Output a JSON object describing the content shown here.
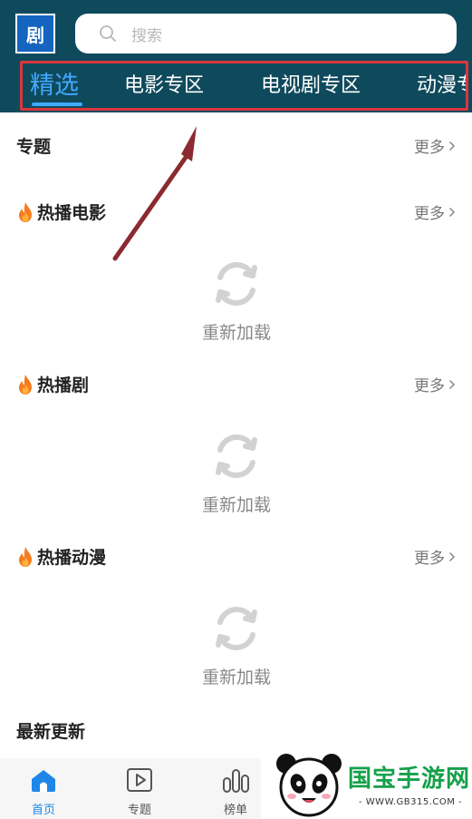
{
  "header": {
    "logo_icon": "app-logo-icon",
    "search": {
      "placeholder": "搜索",
      "icon": "search-icon"
    },
    "tabs": [
      {
        "label": "精选",
        "active": true
      },
      {
        "label": "电影专区",
        "active": false
      },
      {
        "label": "电视剧专区",
        "active": false
      },
      {
        "label": "动漫专区",
        "active": false
      }
    ]
  },
  "colors": {
    "header_bg": "#0f4a5c",
    "accent": "#41a8ff",
    "highlight_border": "#d9363e",
    "arrow": "#8b2a30"
  },
  "sections": [
    {
      "title": "专题",
      "more": "更多",
      "hot": false
    },
    {
      "title": "热播电影",
      "more": "更多",
      "hot": true,
      "reload": "重新加载"
    },
    {
      "title": "热播剧",
      "more": "更多",
      "hot": true,
      "reload": "重新加载"
    },
    {
      "title": "热播动漫",
      "more": "更多",
      "hot": true,
      "reload": "重新加载"
    },
    {
      "title": "最新更新"
    }
  ],
  "bottom_nav": [
    {
      "label": "首页",
      "icon": "home-icon",
      "active": true
    },
    {
      "label": "专题",
      "icon": "play-icon",
      "active": false
    },
    {
      "label": "榜单",
      "icon": "bar-chart-icon",
      "active": false
    }
  ],
  "watermark": {
    "title": "国宝手游网",
    "url": "- WWW.GB315.COM -",
    "icon": "panda-logo-icon"
  }
}
